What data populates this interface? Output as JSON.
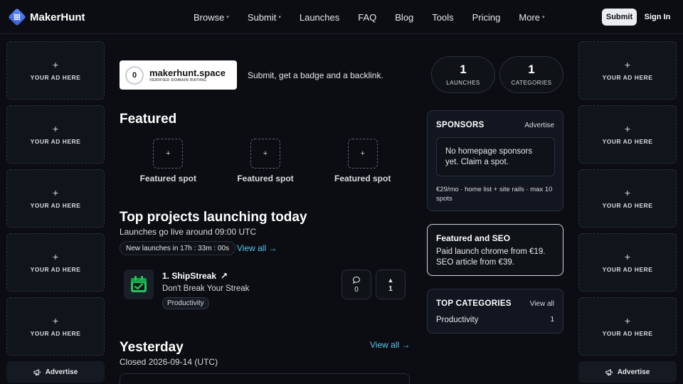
{
  "brand": {
    "name": "MakerHunt"
  },
  "nav": {
    "items": [
      {
        "label": "Browse",
        "has_caret": true
      },
      {
        "label": "Submit",
        "has_caret": true
      },
      {
        "label": "Launches",
        "has_caret": false
      },
      {
        "label": "FAQ",
        "has_caret": false
      },
      {
        "label": "Blog",
        "has_caret": false
      },
      {
        "label": "Tools",
        "has_caret": false
      },
      {
        "label": "Pricing",
        "has_caret": false
      },
      {
        "label": "More",
        "has_caret": true
      }
    ],
    "caret_glyph": "▾",
    "submit_label": "Submit",
    "signin_label": "Sign In"
  },
  "ads": {
    "plus": "+",
    "label": "YOUR AD HERE",
    "advertise_label": "Advertise"
  },
  "badge": {
    "score": "0",
    "domain": "makerhunt.space",
    "subtitle": "VERIFIED DOMAIN RATING",
    "text": "Submit, get a badge and a backlink."
  },
  "stats": [
    {
      "value": "1",
      "label": "LAUNCHES"
    },
    {
      "value": "1",
      "label": "CATEGORIES"
    }
  ],
  "featured": {
    "title": "Featured",
    "plus": "+",
    "spots": [
      "Featured spot",
      "Featured spot",
      "Featured spot"
    ]
  },
  "today": {
    "title": "Top projects launching today",
    "subtitle": "Launches go live around 09:00 UTC",
    "timer": "New launches in 17h : 33m : 00s",
    "view_all": "View all →"
  },
  "project": {
    "title": "1. ShipStreak",
    "arrow": "↗",
    "tagline": "Don't Break Your Streak",
    "tag": "Productivity",
    "comments": "0",
    "upvote_arrow": "▲",
    "upvotes": "1"
  },
  "yesterday": {
    "title": "Yesterday",
    "subtitle": "Closed 2026-09-14 (UTC)",
    "view_all": "View all →"
  },
  "sponsors": {
    "title": "SPONSORS",
    "link": "Advertise",
    "empty_text": "No homepage sponsors yet. Claim a spot.",
    "meta": "€29/mo · home list + site rails · max 10 spots"
  },
  "seo": {
    "title": "Featured and SEO",
    "line1": "Paid launch chrome from €19.",
    "line2": "SEO article from €39."
  },
  "categories": {
    "title": "TOP CATEGORIES",
    "link": "View all",
    "items": [
      {
        "name": "Productivity",
        "count": "1"
      }
    ]
  },
  "colors": {
    "background": "#0b0d12",
    "accent_link": "#5cc8f0",
    "project_icon": "#22c55e"
  }
}
